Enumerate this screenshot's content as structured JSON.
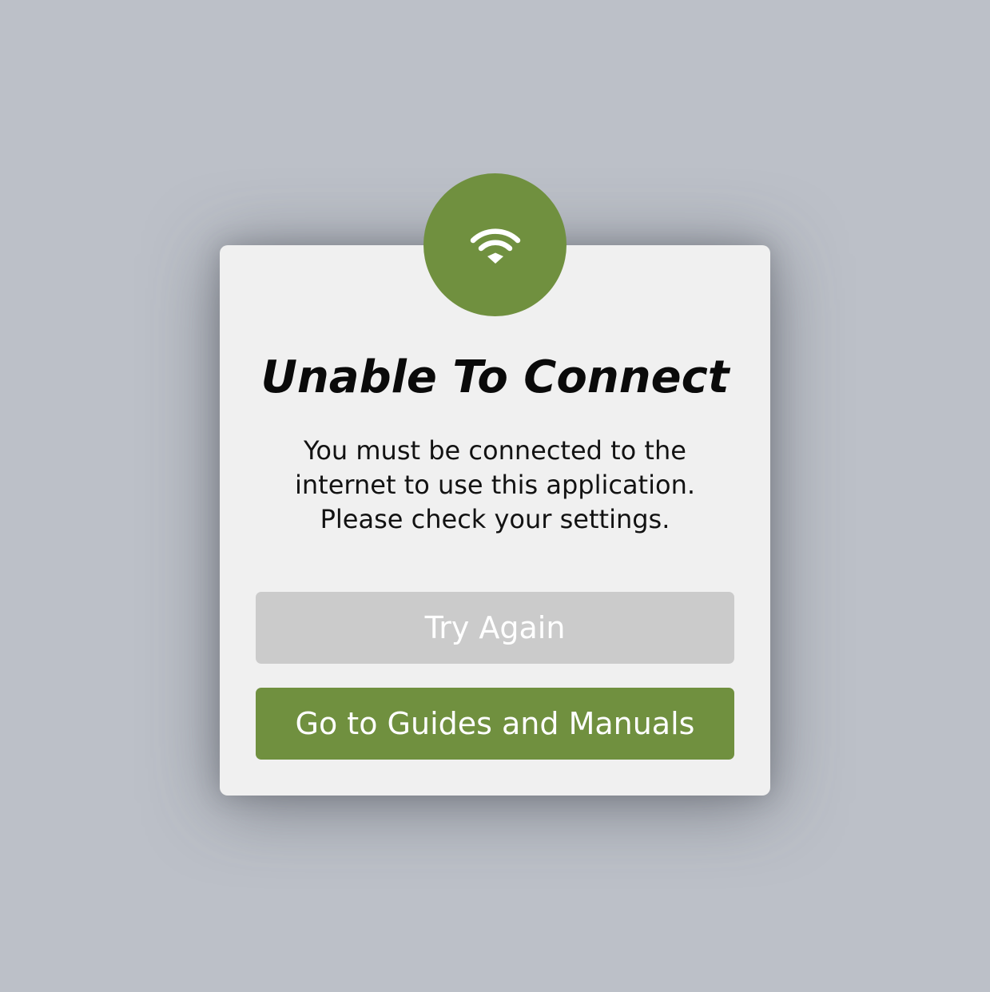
{
  "dialog": {
    "icon": "wifi-icon",
    "title": "Unable To Connect",
    "message_lines": [
      "You must be connected to the",
      "internet to use this application.",
      "Please check your settings."
    ],
    "try_again_label": "Try Again",
    "guides_label": "Go to Guides and Manuals"
  },
  "colors": {
    "accent": "#70903f",
    "disabled_button": "#cbcbcb",
    "dialog_background": "#f0f0f0",
    "page_background": "#bcc0c8"
  }
}
